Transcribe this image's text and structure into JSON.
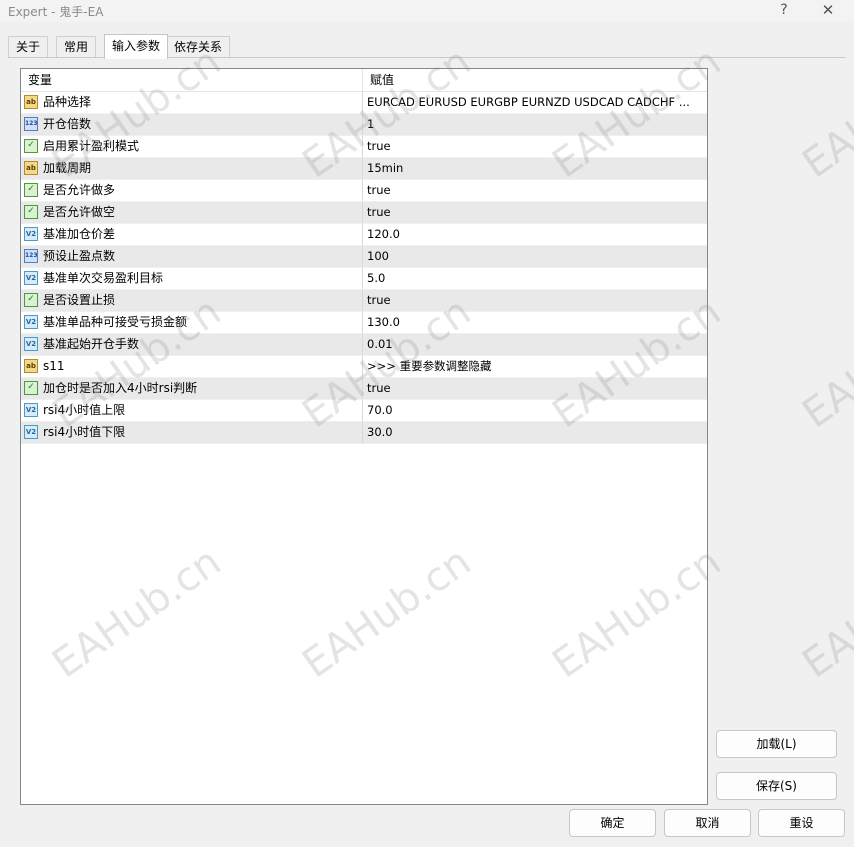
{
  "window": {
    "title": "Expert - 鬼手-EA",
    "help_glyph": "?",
    "close_glyph": "✕"
  },
  "tabs": [
    {
      "label": "关于",
      "active": false
    },
    {
      "label": "常用",
      "active": false
    },
    {
      "label": "输入参数",
      "active": true
    },
    {
      "label": "依存关系",
      "active": false
    }
  ],
  "table": {
    "col_variable": "变量",
    "col_value": "赋值",
    "rows": [
      {
        "type": "ab",
        "type_glyph": "ab",
        "name": "品种选择",
        "value": "EURCAD  EURUSD EURGBP EURNZD  USDCAD CADCHF ..."
      },
      {
        "type": "123",
        "type_glyph": "123",
        "name": "开仓倍数",
        "value": "1"
      },
      {
        "type": "bool",
        "type_glyph": "✓",
        "name": "启用累计盈利模式",
        "value": "true"
      },
      {
        "type": "ab",
        "type_glyph": "ab",
        "name": "加载周期",
        "value": "15min"
      },
      {
        "type": "bool",
        "type_glyph": "✓",
        "name": "是否允许做多",
        "value": "true"
      },
      {
        "type": "bool",
        "type_glyph": "✓",
        "name": "是否允许做空",
        "value": "true"
      },
      {
        "type": "v2",
        "type_glyph": "V2",
        "name": "基准加仓价差",
        "value": "120.0"
      },
      {
        "type": "123",
        "type_glyph": "123",
        "name": "预设止盈点数",
        "value": "100"
      },
      {
        "type": "v2",
        "type_glyph": "V2",
        "name": "基准单次交易盈利目标",
        "value": "5.0"
      },
      {
        "type": "bool",
        "type_glyph": "✓",
        "name": "是否设置止损",
        "value": "true"
      },
      {
        "type": "v2",
        "type_glyph": "V2",
        "name": "基准单品种可接受亏损金额",
        "value": "130.0"
      },
      {
        "type": "v2",
        "type_glyph": "V2",
        "name": "基准起始开仓手数",
        "value": "0.01"
      },
      {
        "type": "ab",
        "type_glyph": "ab",
        "name": "s11",
        "value": ">>> 重要参数调整隐藏"
      },
      {
        "type": "bool",
        "type_glyph": "✓",
        "name": "加仓时是否加入4小时rsi判断",
        "value": "true"
      },
      {
        "type": "v2",
        "type_glyph": "V2",
        "name": "rsi4小时值上限",
        "value": "70.0"
      },
      {
        "type": "v2",
        "type_glyph": "V2",
        "name": "rsi4小时值下限",
        "value": "30.0"
      }
    ]
  },
  "buttons": {
    "load": "加载(L)",
    "save": "保存(S)",
    "ok": "确定",
    "cancel": "取消",
    "reset": "重设"
  },
  "watermark": "EAHub.cn"
}
